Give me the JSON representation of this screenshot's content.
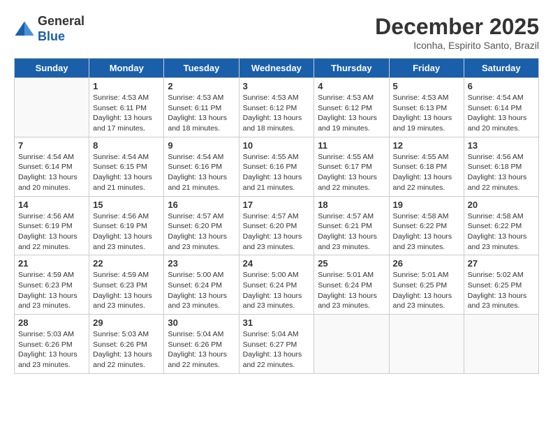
{
  "logo": {
    "line1": "General",
    "line2": "Blue"
  },
  "title": "December 2025",
  "subtitle": "Iconha, Espirito Santo, Brazil",
  "days": [
    "Sunday",
    "Monday",
    "Tuesday",
    "Wednesday",
    "Thursday",
    "Friday",
    "Saturday"
  ],
  "weeks": [
    [
      {
        "day": "",
        "content": ""
      },
      {
        "day": "1",
        "content": "Sunrise: 4:53 AM\nSunset: 6:11 PM\nDaylight: 13 hours\nand 17 minutes."
      },
      {
        "day": "2",
        "content": "Sunrise: 4:53 AM\nSunset: 6:11 PM\nDaylight: 13 hours\nand 18 minutes."
      },
      {
        "day": "3",
        "content": "Sunrise: 4:53 AM\nSunset: 6:12 PM\nDaylight: 13 hours\nand 18 minutes."
      },
      {
        "day": "4",
        "content": "Sunrise: 4:53 AM\nSunset: 6:12 PM\nDaylight: 13 hours\nand 19 minutes."
      },
      {
        "day": "5",
        "content": "Sunrise: 4:53 AM\nSunset: 6:13 PM\nDaylight: 13 hours\nand 19 minutes."
      },
      {
        "day": "6",
        "content": "Sunrise: 4:54 AM\nSunset: 6:14 PM\nDaylight: 13 hours\nand 20 minutes."
      }
    ],
    [
      {
        "day": "7",
        "content": "Sunrise: 4:54 AM\nSunset: 6:14 PM\nDaylight: 13 hours\nand 20 minutes."
      },
      {
        "day": "8",
        "content": "Sunrise: 4:54 AM\nSunset: 6:15 PM\nDaylight: 13 hours\nand 21 minutes."
      },
      {
        "day": "9",
        "content": "Sunrise: 4:54 AM\nSunset: 6:16 PM\nDaylight: 13 hours\nand 21 minutes."
      },
      {
        "day": "10",
        "content": "Sunrise: 4:55 AM\nSunset: 6:16 PM\nDaylight: 13 hours\nand 21 minutes."
      },
      {
        "day": "11",
        "content": "Sunrise: 4:55 AM\nSunset: 6:17 PM\nDaylight: 13 hours\nand 22 minutes."
      },
      {
        "day": "12",
        "content": "Sunrise: 4:55 AM\nSunset: 6:18 PM\nDaylight: 13 hours\nand 22 minutes."
      },
      {
        "day": "13",
        "content": "Sunrise: 4:56 AM\nSunset: 6:18 PM\nDaylight: 13 hours\nand 22 minutes."
      }
    ],
    [
      {
        "day": "14",
        "content": "Sunrise: 4:56 AM\nSunset: 6:19 PM\nDaylight: 13 hours\nand 22 minutes."
      },
      {
        "day": "15",
        "content": "Sunrise: 4:56 AM\nSunset: 6:19 PM\nDaylight: 13 hours\nand 23 minutes."
      },
      {
        "day": "16",
        "content": "Sunrise: 4:57 AM\nSunset: 6:20 PM\nDaylight: 13 hours\nand 23 minutes."
      },
      {
        "day": "17",
        "content": "Sunrise: 4:57 AM\nSunset: 6:20 PM\nDaylight: 13 hours\nand 23 minutes."
      },
      {
        "day": "18",
        "content": "Sunrise: 4:57 AM\nSunset: 6:21 PM\nDaylight: 13 hours\nand 23 minutes."
      },
      {
        "day": "19",
        "content": "Sunrise: 4:58 AM\nSunset: 6:22 PM\nDaylight: 13 hours\nand 23 minutes."
      },
      {
        "day": "20",
        "content": "Sunrise: 4:58 AM\nSunset: 6:22 PM\nDaylight: 13 hours\nand 23 minutes."
      }
    ],
    [
      {
        "day": "21",
        "content": "Sunrise: 4:59 AM\nSunset: 6:23 PM\nDaylight: 13 hours\nand 23 minutes."
      },
      {
        "day": "22",
        "content": "Sunrise: 4:59 AM\nSunset: 6:23 PM\nDaylight: 13 hours\nand 23 minutes."
      },
      {
        "day": "23",
        "content": "Sunrise: 5:00 AM\nSunset: 6:24 PM\nDaylight: 13 hours\nand 23 minutes."
      },
      {
        "day": "24",
        "content": "Sunrise: 5:00 AM\nSunset: 6:24 PM\nDaylight: 13 hours\nand 23 minutes."
      },
      {
        "day": "25",
        "content": "Sunrise: 5:01 AM\nSunset: 6:24 PM\nDaylight: 13 hours\nand 23 minutes."
      },
      {
        "day": "26",
        "content": "Sunrise: 5:01 AM\nSunset: 6:25 PM\nDaylight: 13 hours\nand 23 minutes."
      },
      {
        "day": "27",
        "content": "Sunrise: 5:02 AM\nSunset: 6:25 PM\nDaylight: 13 hours\nand 23 minutes."
      }
    ],
    [
      {
        "day": "28",
        "content": "Sunrise: 5:03 AM\nSunset: 6:26 PM\nDaylight: 13 hours\nand 23 minutes."
      },
      {
        "day": "29",
        "content": "Sunrise: 5:03 AM\nSunset: 6:26 PM\nDaylight: 13 hours\nand 22 minutes."
      },
      {
        "day": "30",
        "content": "Sunrise: 5:04 AM\nSunset: 6:26 PM\nDaylight: 13 hours\nand 22 minutes."
      },
      {
        "day": "31",
        "content": "Sunrise: 5:04 AM\nSunset: 6:27 PM\nDaylight: 13 hours\nand 22 minutes."
      },
      {
        "day": "",
        "content": ""
      },
      {
        "day": "",
        "content": ""
      },
      {
        "day": "",
        "content": ""
      }
    ]
  ]
}
